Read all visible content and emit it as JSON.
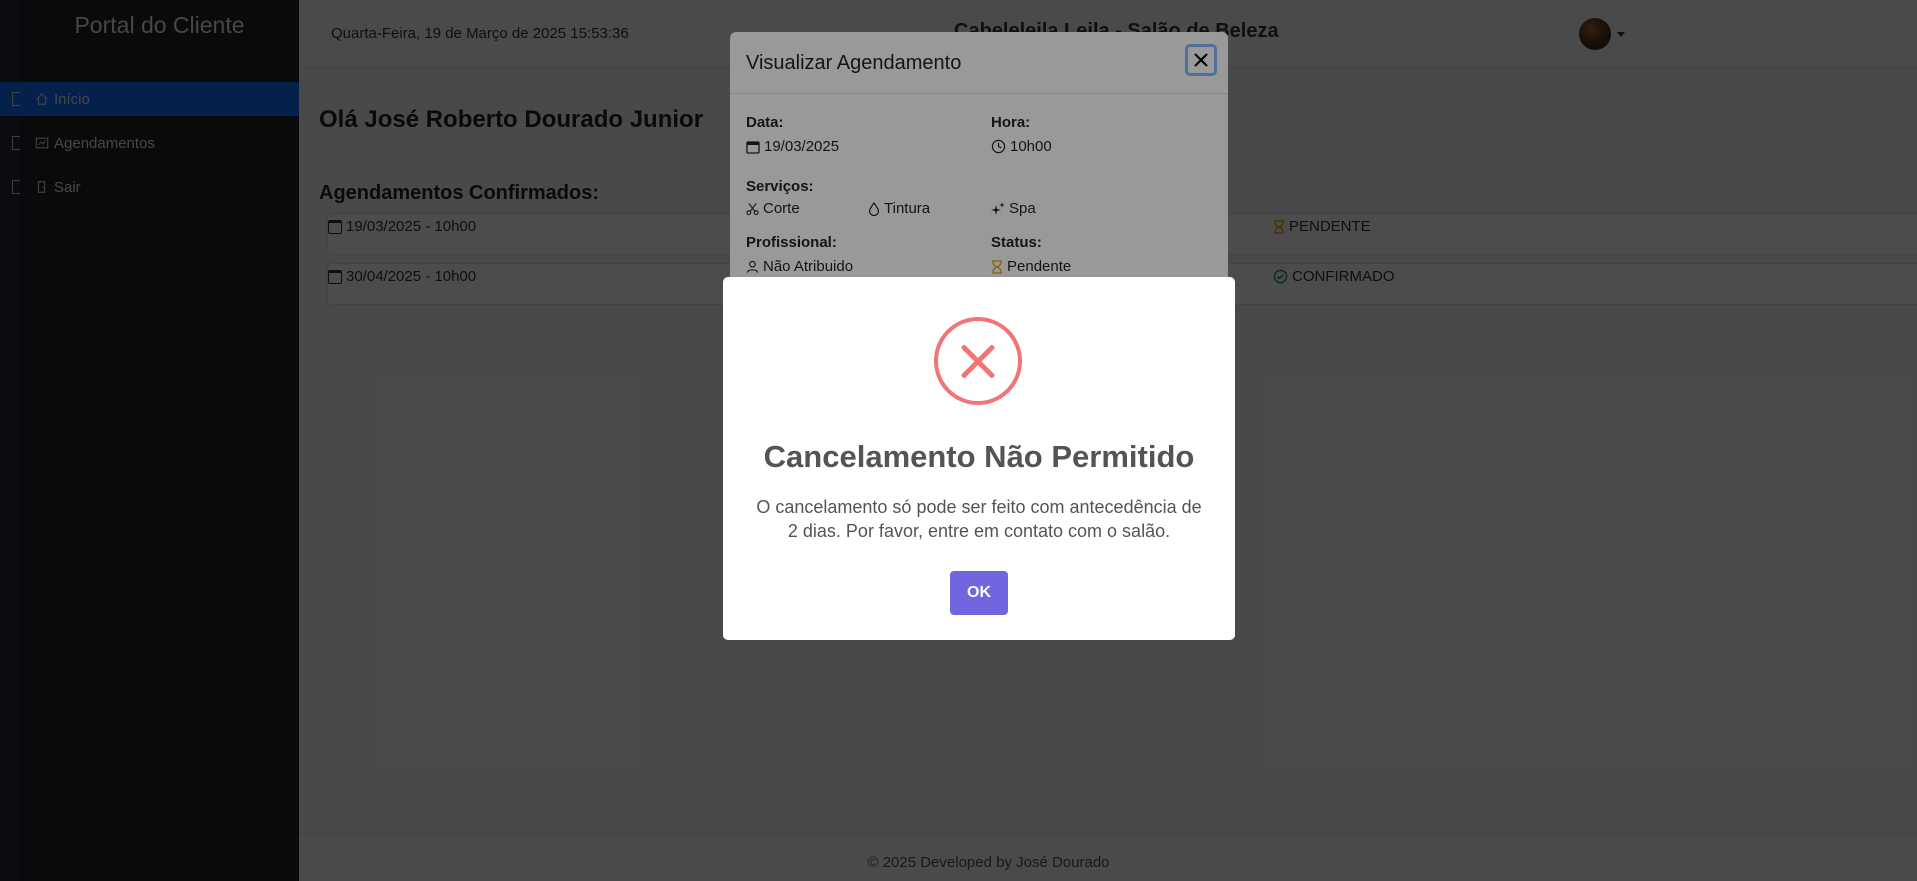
{
  "sidebar": {
    "brand": "Portal do Cliente",
    "items": [
      {
        "label": "Início",
        "icon": "home-icon",
        "active": true
      },
      {
        "label": "Agendamentos",
        "icon": "calendar-chart-icon",
        "active": false
      },
      {
        "label": "Sair",
        "icon": "logout-icon",
        "active": false
      }
    ]
  },
  "topbar": {
    "datetime": "Quarta-Feira, 19 de Março de 2025 15:53:36",
    "salon_name": "Cabeleleila Leila - Salão de Beleza"
  },
  "main": {
    "greeting": "Olá José Roberto Dourado Junior",
    "section_title": "Agendamentos Confirmados:",
    "appointments": [
      {
        "when": "19/03/2025 - 10h00",
        "status": "PENDENTE",
        "status_icon": "hourglass-icon"
      },
      {
        "when": "30/04/2025 - 10h00",
        "status": "CONFIRMADO",
        "status_icon": "check-circle-icon"
      }
    ]
  },
  "footer": {
    "text": "© 2025 Developed by José Dourado"
  },
  "view_modal": {
    "title": "Visualizar Agendamento",
    "date_label": "Data:",
    "date_value": "19/03/2025",
    "time_label": "Hora:",
    "time_value": "10h00",
    "services_label": "Serviços:",
    "services": [
      "Corte",
      "Tintura",
      "Spa"
    ],
    "professional_label": "Profissional:",
    "professional_value": "Não Atribuido",
    "status_label": "Status:",
    "status_value": "Pendente"
  },
  "alert": {
    "title": "Cancelamento Não Permitido",
    "text": "O cancelamento só pode ser feito com antecedência de 2 dias. Por favor, entre em contato com o salão.",
    "ok_label": "OK",
    "icon": "error-x-icon"
  },
  "colors": {
    "sidebar_bg": "#212529",
    "active_nav": "#0d6efd",
    "error": "#f27474",
    "ok_button": "#7066e0",
    "pending": "#e0a800",
    "confirmed": "#198754"
  }
}
